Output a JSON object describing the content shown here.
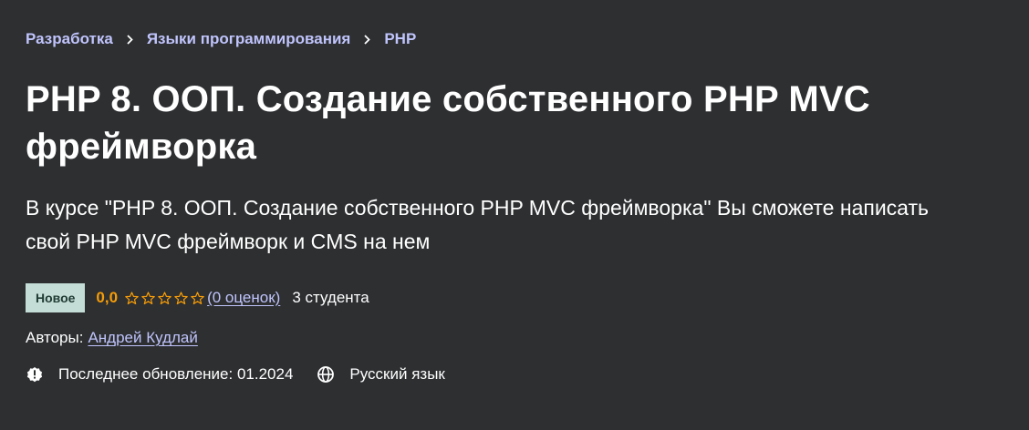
{
  "breadcrumb": {
    "items": [
      {
        "label": "Разработка"
      },
      {
        "label": "Языки программирования"
      },
      {
        "label": "PHP"
      }
    ]
  },
  "course": {
    "title": "PHP 8. ООП. Создание собственного PHP MVC фреймворка",
    "subtitle": "В курсе \"PHP 8. ООП. Создание собственного PHP MVC фреймворка\" Вы сможете написать свой PHP MVC фреймворк и CMS на нем"
  },
  "rating": {
    "badge": "Новое",
    "value": "0,0",
    "stars_filled": 0,
    "stars_total": 5,
    "count_link": "(0 оценок)",
    "students": "3 студента"
  },
  "authors": {
    "label": "Авторы:",
    "name": "Андрей Кудлай"
  },
  "meta": {
    "last_updated": "Последнее обновление: 01.2024",
    "language": "Русский язык",
    "update_icon": "alert-badge-icon",
    "language_icon": "globe-icon"
  },
  "colors": {
    "background": "#2d2f31",
    "link": "#c0c4fc",
    "rating": "#f69c08",
    "badge_bg": "#c4ddd6",
    "badge_text": "#1f3b33"
  }
}
